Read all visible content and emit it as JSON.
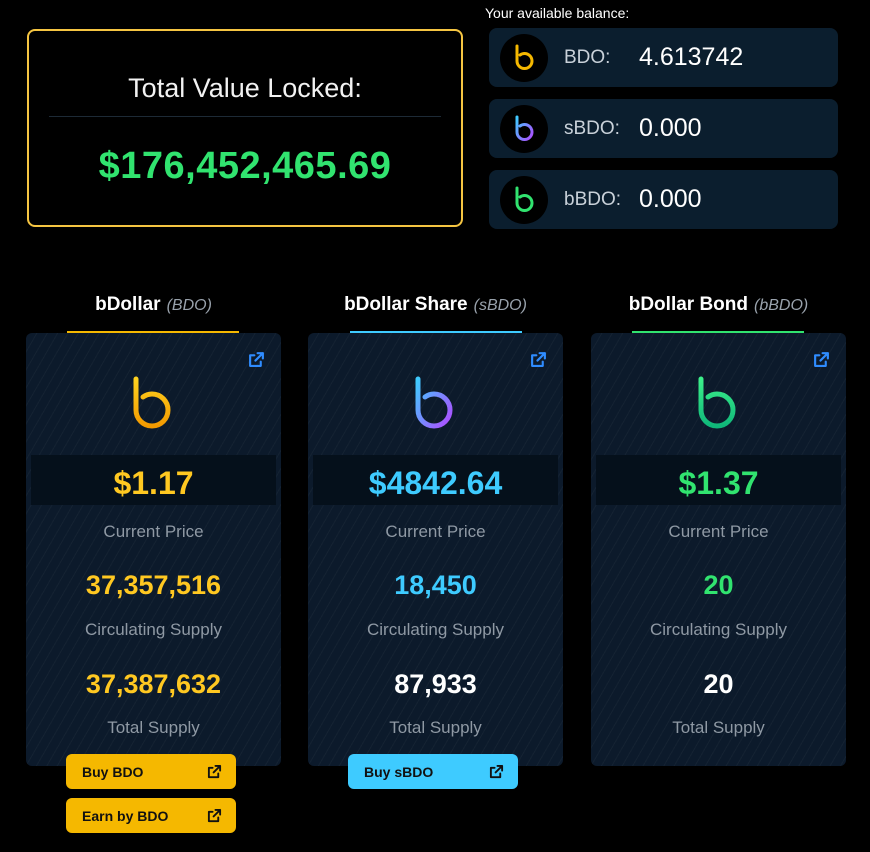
{
  "tvl": {
    "title": "Total Value Locked:",
    "value": "$176,452,465.69"
  },
  "balance": {
    "title": "Your available balance:",
    "rows": [
      {
        "name": "BDO:",
        "value": "4.613742",
        "icon": "bdo-logo-icon",
        "color": "#f5b800"
      },
      {
        "name": "sBDO:",
        "value": "0.000",
        "icon": "sbdo-logo-icon",
        "color": "#7b61ff"
      },
      {
        "name": "bBDO:",
        "value": "0.000",
        "icon": "bbdo-logo-icon",
        "color": "#31e36f"
      }
    ]
  },
  "columns": [
    {
      "name": "bDollar",
      "ticker": "(BDO)",
      "accent": "#f5b800",
      "price": "$1.17",
      "price_label": "Current Price",
      "circulating": "37,357,516",
      "circulating_label": "Circulating Supply",
      "total": "37,387,632",
      "total_label": "Total Supply",
      "buttons": [
        {
          "label": "Buy BDO"
        },
        {
          "label": "Earn by BDO"
        }
      ]
    },
    {
      "name": "bDollar Share",
      "ticker": "(sBDO)",
      "accent": "#3ecbff",
      "price": "$4842.64",
      "price_label": "Current Price",
      "circulating": "18,450",
      "circulating_label": "Circulating Supply",
      "total": "87,933",
      "total_label": "Total Supply",
      "buttons": [
        {
          "label": "Buy sBDO"
        }
      ]
    },
    {
      "name": "bDollar Bond",
      "ticker": "(bBDO)",
      "accent": "#31e36f",
      "price": "$1.37",
      "price_label": "Current Price",
      "circulating": "20",
      "circulating_label": "Circulating Supply",
      "total": "20",
      "total_label": "Total Supply",
      "buttons": []
    }
  ]
}
